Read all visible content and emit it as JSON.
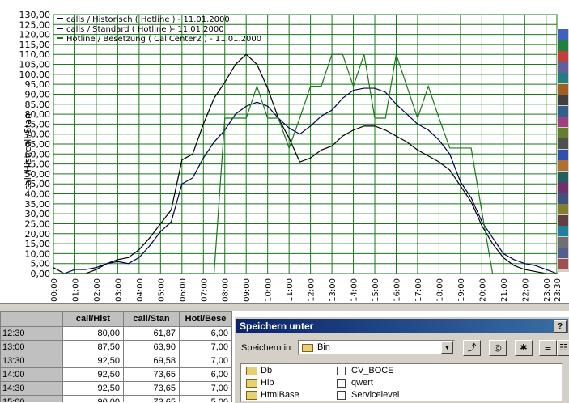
{
  "chart_data": {
    "type": "line",
    "ylabel": "call/Hist,call/Stan",
    "ylim": [
      0,
      130
    ],
    "y_ticks": [
      "0,00",
      "5,00",
      "10,00",
      "15,00",
      "20,00",
      "25,00",
      "30,00",
      "35,00",
      "40,00",
      "45,00",
      "50,00",
      "55,00",
      "60,00",
      "65,00",
      "70,00",
      "75,00",
      "80,00",
      "85,00",
      "90,00",
      "95,00",
      "100,00",
      "105,00",
      "110,00",
      "115,00",
      "120,00",
      "125,00",
      "130,00"
    ],
    "x_ticks": [
      "00:00",
      "01:00",
      "02:00",
      "03:00",
      "04:00",
      "05:00",
      "06:00",
      "07:00",
      "08:00",
      "09:00",
      "10:00",
      "11:00",
      "12:00",
      "13:00",
      "14:00",
      "15:00",
      "16:00",
      "17:00",
      "18:00",
      "19:00",
      "20:00",
      "21:00",
      "22:00",
      "23:00",
      "23:30"
    ],
    "x_hours": [
      0,
      0.5,
      1,
      1.5,
      2,
      2.5,
      3,
      3.5,
      4,
      4.5,
      5,
      5.5,
      6,
      6.5,
      7,
      7.5,
      8,
      8.5,
      9,
      9.5,
      10,
      10.5,
      11,
      11.5,
      12,
      12.5,
      13,
      13.5,
      14,
      14.5,
      15,
      15.5,
      16,
      16.5,
      17,
      17.5,
      18,
      18.5,
      19,
      19.5,
      20,
      20.5,
      21,
      21.5,
      22,
      22.5,
      23,
      23.5
    ],
    "grid": true,
    "legend_position": "top-left",
    "series": [
      {
        "name": "calls / Historisch ( Hotline ) - 11.01.2000",
        "color": "#000000",
        "values": [
          3,
          0,
          0,
          0,
          2,
          5,
          7,
          8,
          12,
          18,
          25,
          32,
          57,
          60,
          75,
          88,
          96,
          105,
          110,
          105,
          93,
          78,
          68,
          56,
          58,
          62,
          64,
          69,
          72,
          74,
          74,
          72,
          69,
          66,
          62,
          59,
          56,
          52,
          44,
          36,
          24,
          15,
          8,
          4,
          2,
          1,
          0,
          0
        ]
      },
      {
        "name": "calls / Standard ( Hotline )- 11.01.2000",
        "color": "#000050",
        "values": [
          0,
          0,
          2,
          2,
          3,
          5,
          6,
          5,
          8,
          14,
          21,
          26,
          45,
          48,
          58,
          66,
          72,
          80,
          84,
          86,
          84,
          78,
          73,
          70,
          74,
          79,
          82,
          88,
          92,
          93,
          93,
          91,
          85,
          80,
          75,
          72,
          67,
          60,
          46,
          38,
          26,
          18,
          10,
          7,
          5,
          4,
          2,
          0
        ]
      },
      {
        "name": "Hotline / Besetzung ( CallCenter2 ) - 11.01.2000",
        "color": "#1a7a1a",
        "values": [
          0,
          0,
          0,
          0,
          0,
          0,
          0,
          0,
          0,
          0,
          0,
          0,
          0,
          0,
          0,
          0,
          78,
          78,
          78,
          94,
          78,
          78,
          63,
          78,
          94,
          94,
          110,
          110,
          94,
          110,
          78,
          78,
          110,
          94,
          78,
          94,
          78,
          63,
          63,
          63,
          31,
          0,
          0,
          0,
          0,
          0,
          0,
          0
        ]
      }
    ]
  },
  "table": {
    "headers": [
      "",
      "call/Hist",
      "call/Stan",
      "Hotl/Bese"
    ],
    "rows": [
      [
        "12:30",
        "80,00",
        "61,87",
        "6,00"
      ],
      [
        "13:00",
        "87,50",
        "63,90",
        "7,00"
      ],
      [
        "13:30",
        "92,50",
        "69,58",
        "7,00"
      ],
      [
        "14:00",
        "92,50",
        "73,65",
        "6,00"
      ],
      [
        "14:30",
        "92,50",
        "73,65",
        "7,00"
      ],
      [
        "15:00",
        "90,00",
        "73,65",
        "5,00"
      ]
    ]
  },
  "dialog": {
    "title": "Speichern unter",
    "help": "?",
    "lookin_label": "Speichern in:",
    "lookin_value": "Bin",
    "files": [
      {
        "name": "Db",
        "icon": "folder-icon"
      },
      {
        "name": "Hlp",
        "icon": "folder-icon"
      },
      {
        "name": "HtmlBase",
        "icon": "folder-icon"
      },
      {
        "name": "CV_BOCE",
        "icon": "document-icon"
      },
      {
        "name": "qwert",
        "icon": "document-icon"
      },
      {
        "name": "Servicelevel",
        "icon": "document-icon"
      }
    ]
  }
}
